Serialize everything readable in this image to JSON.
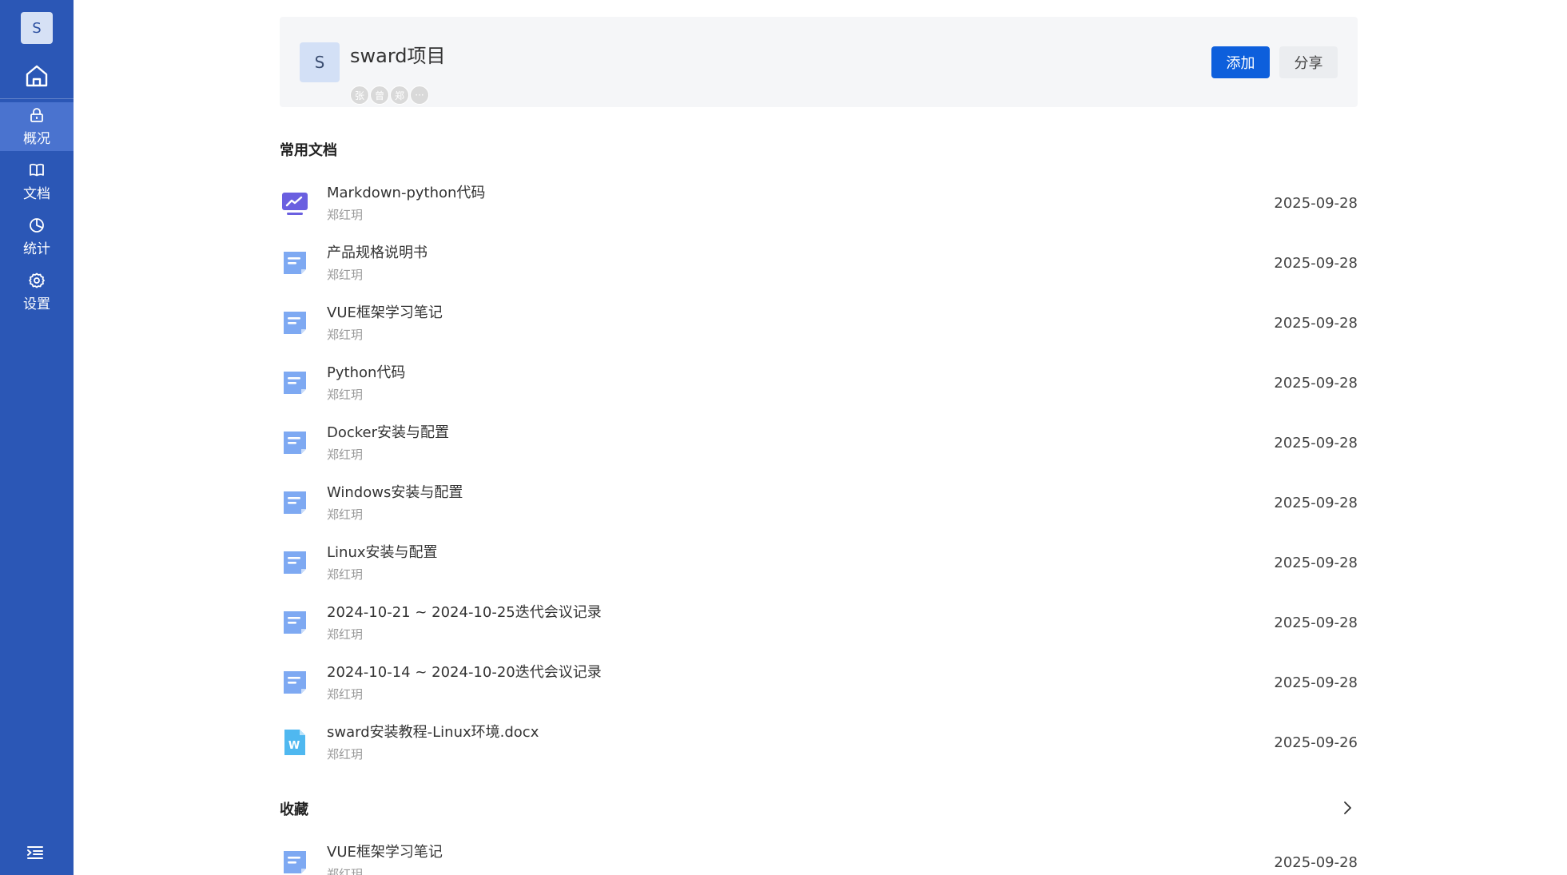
{
  "sidebar": {
    "workspace_initial": "S",
    "nav": [
      {
        "label": "概况",
        "icon": "lock-icon",
        "active": true
      },
      {
        "label": "文档",
        "icon": "book-icon",
        "active": false
      },
      {
        "label": "统计",
        "icon": "pie-chart-icon",
        "active": false
      },
      {
        "label": "设置",
        "icon": "gear-icon",
        "active": false
      }
    ]
  },
  "header": {
    "project_initial": "S",
    "project_name": "sward项目",
    "members": [
      "张",
      "曾",
      "郑",
      "···"
    ],
    "add_label": "添加",
    "share_label": "分享"
  },
  "recent": {
    "title": "常用文档",
    "items": [
      {
        "title": "Markdown-python代码",
        "author": "郑红玥",
        "date": "2025-09-28",
        "icon": "markdown-doc-icon"
      },
      {
        "title": "产品规格说明书",
        "author": "郑红玥",
        "date": "2025-09-28",
        "icon": "doc-icon"
      },
      {
        "title": "VUE框架学习笔记",
        "author": "郑红玥",
        "date": "2025-09-28",
        "icon": "doc-icon"
      },
      {
        "title": "Python代码",
        "author": "郑红玥",
        "date": "2025-09-28",
        "icon": "doc-icon"
      },
      {
        "title": "Docker安装与配置",
        "author": "郑红玥",
        "date": "2025-09-28",
        "icon": "doc-icon"
      },
      {
        "title": "Windows安装与配置",
        "author": "郑红玥",
        "date": "2025-09-28",
        "icon": "doc-icon"
      },
      {
        "title": "Linux安装与配置",
        "author": "郑红玥",
        "date": "2025-09-28",
        "icon": "doc-icon"
      },
      {
        "title": "2024-10-21 ~ 2024-10-25迭代会议记录",
        "author": "郑红玥",
        "date": "2025-09-28",
        "icon": "doc-icon"
      },
      {
        "title": "2024-10-14 ~ 2024-10-20迭代会议记录",
        "author": "郑红玥",
        "date": "2025-09-28",
        "icon": "doc-icon"
      },
      {
        "title": "sward安装教程-Linux环境.docx",
        "author": "郑红玥",
        "date": "2025-09-26",
        "icon": "word-file-icon"
      }
    ]
  },
  "favorites": {
    "title": "收藏",
    "items": [
      {
        "title": "VUE框架学习笔记",
        "author": "郑红玥",
        "date": "2025-09-28",
        "icon": "doc-icon"
      }
    ]
  },
  "colors": {
    "sidebar_bg": "#2b57b6",
    "sidebar_active": "#4a73cf",
    "primary": "#0d5fdc",
    "doc_icon": "#7ea9f2",
    "markdown_icon": "#6a5fe0",
    "word_icon": "#4fb8f0"
  }
}
